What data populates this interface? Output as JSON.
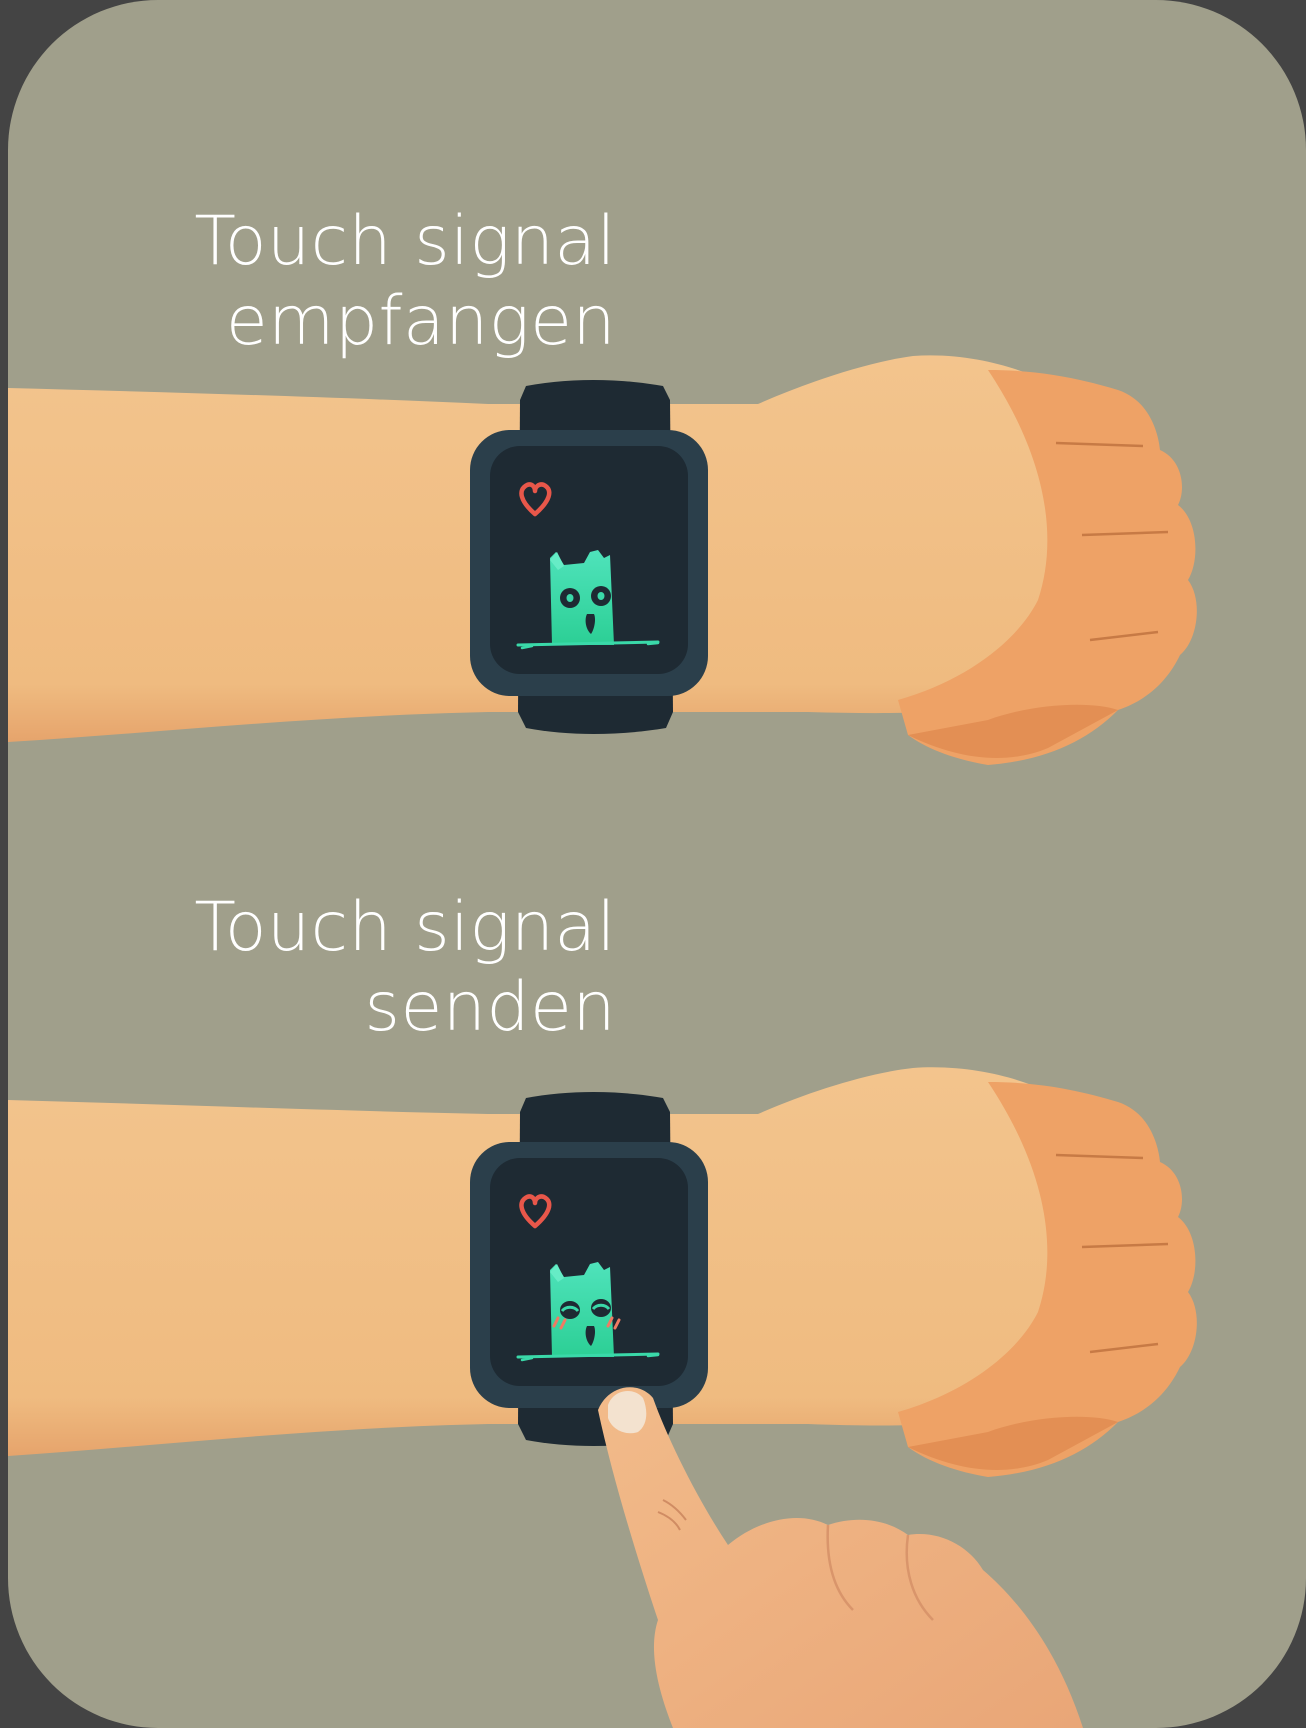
{
  "colors": {
    "page_background": "#444444",
    "card_background": "#a09f8b",
    "skin": "#f1bd83",
    "skin_shadow": "#e3a06a",
    "fist": "#eea266",
    "watch_band": "#1e2a33",
    "watch_bezel": "#2b3f4b",
    "watch_screen": "#1e2a33",
    "heart": "#e8574a",
    "creature": "#3ad9a9",
    "caption_text": "#ffffff"
  },
  "panels": [
    {
      "caption_line1": "Touch signal",
      "caption_line2": "empfangen",
      "icons": [
        "heart-icon",
        "creature-icon"
      ]
    },
    {
      "caption_line1": "Touch signal",
      "caption_line2": "senden",
      "icons": [
        "heart-icon",
        "blushing-creature-icon",
        "pointing-finger-icon"
      ]
    }
  ]
}
